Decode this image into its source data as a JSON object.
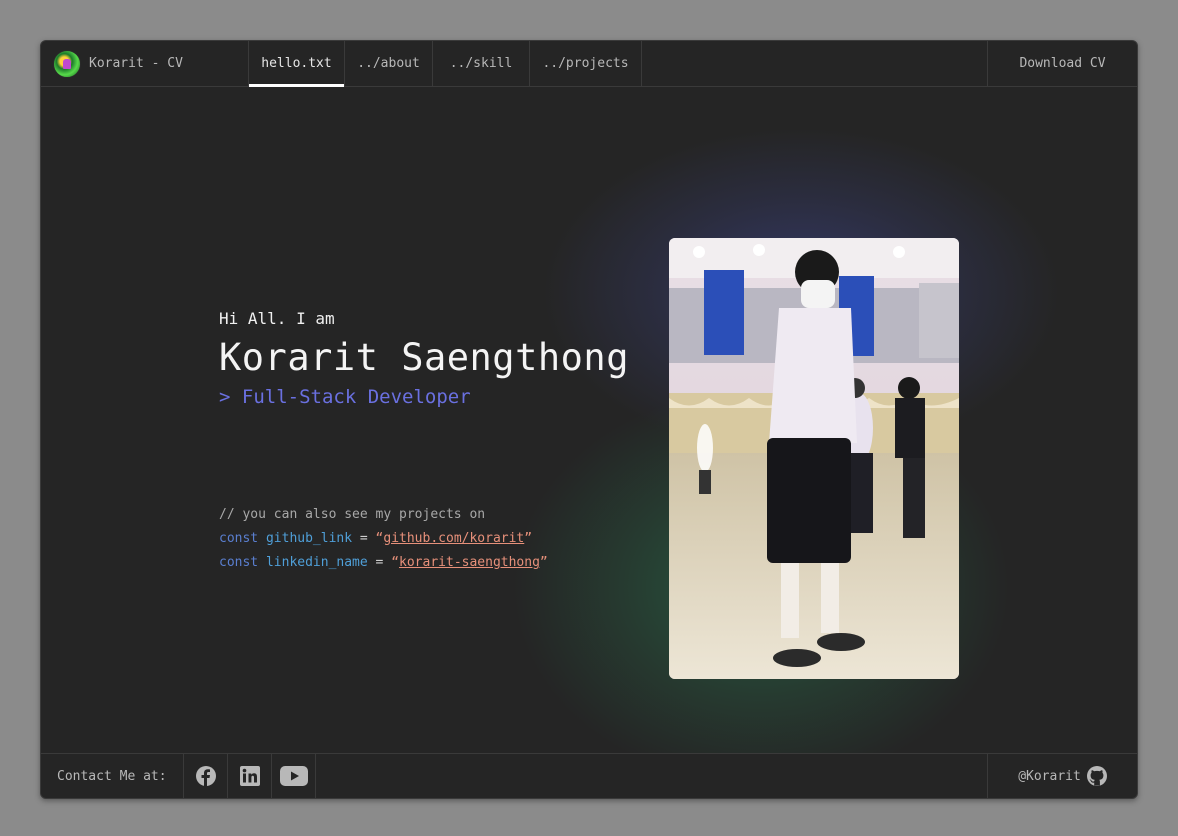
{
  "header": {
    "brand": "Korarit - CV",
    "tabs": [
      {
        "label": "hello.txt",
        "active": true
      },
      {
        "label": "../about",
        "active": false
      },
      {
        "label": "../skill",
        "active": false
      },
      {
        "label": "../projects",
        "active": false
      }
    ],
    "download_label": "Download CV"
  },
  "hero": {
    "greeting": "Hi All. I am",
    "name": "Korarit Saengthong",
    "role": "> Full-Stack Developer",
    "comment": "// you can also see my projects on",
    "lines": [
      {
        "keyword": "const",
        "name": "github_link",
        "op": "=",
        "value": "github.com/korarit"
      },
      {
        "keyword": "const",
        "name": "linkedin_name",
        "op": "=",
        "value": "korarit-saengthong"
      }
    ]
  },
  "footer": {
    "contact_label": "Contact Me at:",
    "social_icons": [
      "facebook-icon",
      "linkedin-icon",
      "youtube-icon"
    ],
    "handle": "@Korarit",
    "handle_icon": "github-icon"
  },
  "colors": {
    "background": "#252525",
    "accent": "#6a70e0",
    "string": "#e7907a",
    "keyword": "#5a7fd0"
  }
}
